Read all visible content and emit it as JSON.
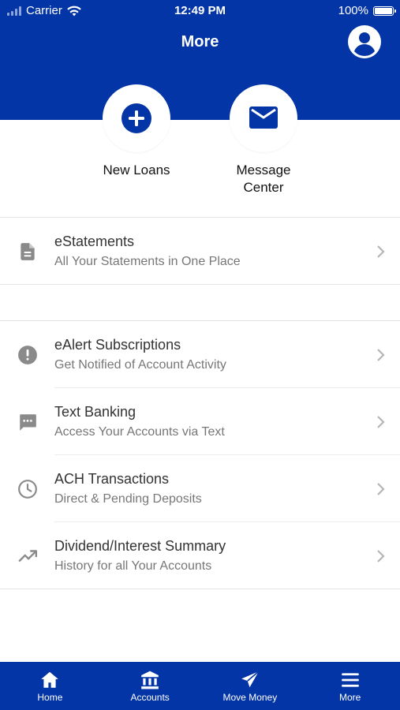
{
  "status_bar": {
    "carrier": "Carrier",
    "time": "12:49 PM",
    "battery": "100%",
    "battery_level": 1.0
  },
  "header": {
    "title": "More",
    "profile_icon": "account-circle-icon"
  },
  "quick_actions": [
    {
      "label": "New Loans",
      "icon": "plus-circle-icon"
    },
    {
      "label": "Message Center",
      "icon": "envelope-icon"
    }
  ],
  "menu": [
    {
      "title": "eStatements",
      "subtitle": "All Your Statements in One Place",
      "icon": "document-icon"
    },
    {
      "title": "eAlert Subscriptions",
      "subtitle": "Get Notified of Account Activity",
      "icon": "alert-circle-icon"
    },
    {
      "title": "Text Banking",
      "subtitle": "Access Your Accounts via Text",
      "icon": "chat-bubble-icon"
    },
    {
      "title": "ACH Transactions",
      "subtitle": "Direct & Pending Deposits",
      "icon": "clock-icon"
    },
    {
      "title": "Dividend/Interest Summary",
      "subtitle": "History for all Your Accounts",
      "icon": "trending-up-icon"
    }
  ],
  "tabbar": {
    "items": [
      {
        "label": "Home",
        "icon": "home-icon"
      },
      {
        "label": "Accounts",
        "icon": "bank-icon"
      },
      {
        "label": "Move Money",
        "icon": "send-icon"
      },
      {
        "label": "More",
        "icon": "menu-icon"
      }
    ],
    "active": "More"
  },
  "colors": {
    "brand_blue": "#0435a6",
    "icon_gray": "#8a8a8a",
    "chevron_gray": "#b5b5b5"
  }
}
